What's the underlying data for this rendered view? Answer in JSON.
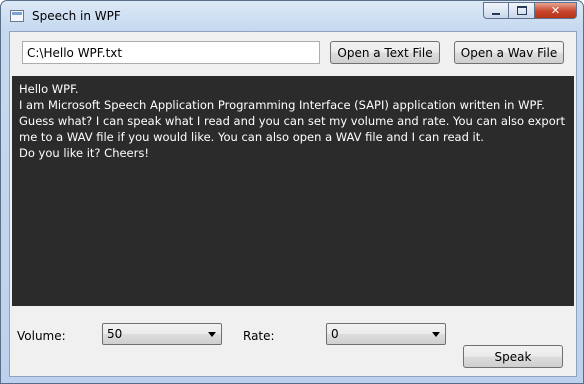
{
  "window": {
    "title": "Speech in WPF",
    "close_glyph": "✕"
  },
  "file_path": {
    "value": "C:\\Hello WPF.txt"
  },
  "buttons": {
    "open_text_file": "Open a Text File",
    "open_wav_file": "Open a Wav File",
    "speak": "Speak"
  },
  "content": {
    "paragraphs": [
      "Hello WPF.",
      "",
      "I am Microsoft Speech Application Programming Interface (SAPI) application written in WPF. Guess what? I can speak what I read and you can set my volume and rate. You can also export me to a WAV file if you would like. You can also open a WAV file and I can read it.",
      "",
      "",
      "",
      "Do you like it? Cheers!"
    ]
  },
  "controls": {
    "volume_label": "Volume:",
    "volume_value": "50",
    "rate_label": "Rate:",
    "rate_value": "0"
  },
  "icons": {
    "app": "window-app-icon",
    "minimize": "minimize-icon",
    "maximize": "maximize-icon",
    "close": "close-icon",
    "dropdown": "chevron-down-icon"
  }
}
